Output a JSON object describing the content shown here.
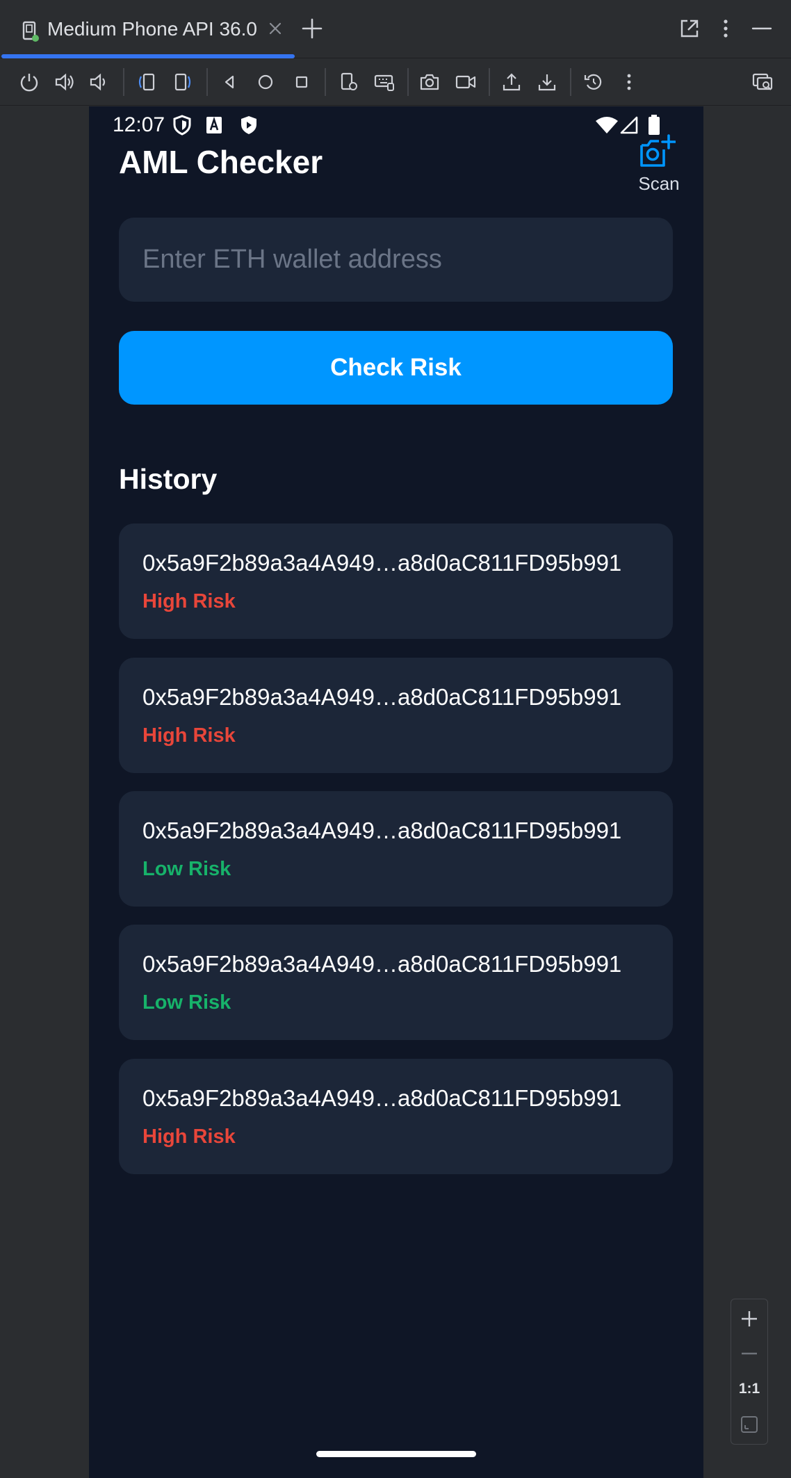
{
  "ide": {
    "tab_title": "Medium Phone API 36.0",
    "accent_color": "#3574f0"
  },
  "toolbar": {
    "icons": [
      "power-icon",
      "volume-up-icon",
      "volume-down-icon",
      "rotate-left-icon",
      "rotate-right-icon",
      "back-icon",
      "home-icon",
      "overview-icon",
      "device-settings-icon",
      "keyboard-icon",
      "camera-icon",
      "record-icon",
      "export-icon",
      "import-icon",
      "snapshot-icon",
      "more-icon",
      "device-mirror-icon"
    ]
  },
  "status_bar": {
    "time": "12:07"
  },
  "app": {
    "title": "AML Checker",
    "scan_label": "Scan",
    "address_placeholder": "Enter ETH wallet address",
    "check_button_label": "Check Risk",
    "history_title": "History",
    "colors": {
      "background": "#0f1626",
      "card": "#1c2638",
      "primary": "#0096ff",
      "high_risk": "#e8463a",
      "low_risk": "#17b26a"
    },
    "history": [
      {
        "address": "0x5a9F2b89a3a4A949…a8d0aC811FD95b991",
        "risk": "High Risk",
        "level": "high"
      },
      {
        "address": "0x5a9F2b89a3a4A949…a8d0aC811FD95b991",
        "risk": "High Risk",
        "level": "high"
      },
      {
        "address": "0x5a9F2b89a3a4A949…a8d0aC811FD95b991",
        "risk": "Low Risk",
        "level": "low"
      },
      {
        "address": "0x5a9F2b89a3a4A949…a8d0aC811FD95b991",
        "risk": "Low Risk",
        "level": "low"
      },
      {
        "address": "0x5a9F2b89a3a4A949…a8d0aC811FD95b991",
        "risk": "High Risk",
        "level": "high"
      }
    ]
  },
  "zoom": {
    "ratio_label": "1:1"
  }
}
